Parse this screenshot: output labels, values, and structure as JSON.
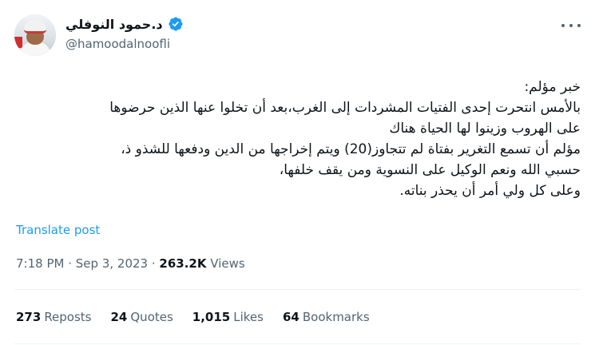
{
  "author": {
    "name": "د.حمود النوفلي",
    "handle": "@hamoodalnoofli"
  },
  "tweet": {
    "lines": [
      "خبر مؤلم:",
      "بالأمس انتحرت إحدى الفتيات المشردات إلى الغرب،بعد أن تخلوا عنها الذين حرضوها",
      "على الهروب وزينوا لها الحياة هناك",
      "مؤلم أن تسمع التغرير بفتاة لم تتجاوز(20) ويتم إخراجها من الدين ودفعها للشذو ذ،",
      "حسبي الله ونعم الوكيل على النسوية ومن يقف خلفها،",
      "وعلى كل ولي أمر أن يحذر بناته."
    ],
    "translate_label": "Translate post",
    "time": "7:18 PM",
    "date": "Sep 3, 2023",
    "views_count": "263.2K",
    "views_label": "Views"
  },
  "stats": {
    "reposts_count": "273",
    "reposts_label": "Reposts",
    "quotes_count": "24",
    "quotes_label": "Quotes",
    "likes_count": "1,015",
    "likes_label": "Likes",
    "bookmarks_count": "64",
    "bookmarks_label": "Bookmarks"
  },
  "colors": {
    "verified_badge": "#1d9bf0",
    "link": "#1d9bf0",
    "secondary_text": "#536471"
  }
}
